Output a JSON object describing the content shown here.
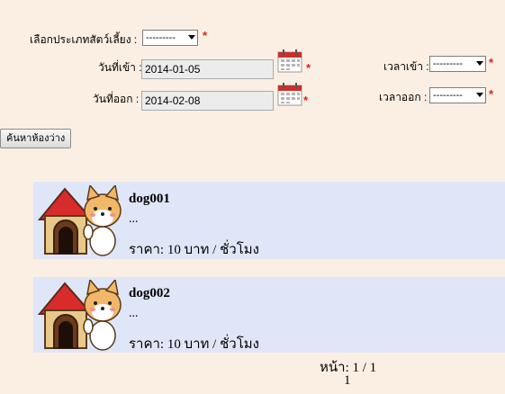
{
  "form": {
    "pet_type_label": "เลือกประเภทสัตว์เลี้ยง :",
    "pet_type_value": "---------",
    "checkin_date_label": "วันที่เข้า :",
    "checkin_date_value": "2014-01-05",
    "checkout_date_label": "วันที่ออก :",
    "checkout_date_value": "2014-02-08",
    "checkin_time_label": "เวลาเข้า :",
    "checkin_time_value": "---------",
    "checkout_time_label": "เวลาออก :",
    "checkout_time_value": "---------",
    "required_mark": "*",
    "search_button": "ค้นหาห้องว่าง"
  },
  "rooms": [
    {
      "name": "dog001",
      "desc": "...",
      "price": "ราคา: 10 บาท / ชั่วโมง"
    },
    {
      "name": "dog002",
      "desc": "...",
      "price": "ราคา: 10 บาท / ชั่วโมง"
    }
  ],
  "pager": {
    "page_text": "หน้า: 1 / 1",
    "page_link": "1"
  },
  "icons": {
    "calendar": "calendar-icon",
    "room_image": "dog-house-icon"
  },
  "colors": {
    "background": "#fbefe4",
    "card": "#dfe6f7",
    "required": "#e0201d"
  }
}
